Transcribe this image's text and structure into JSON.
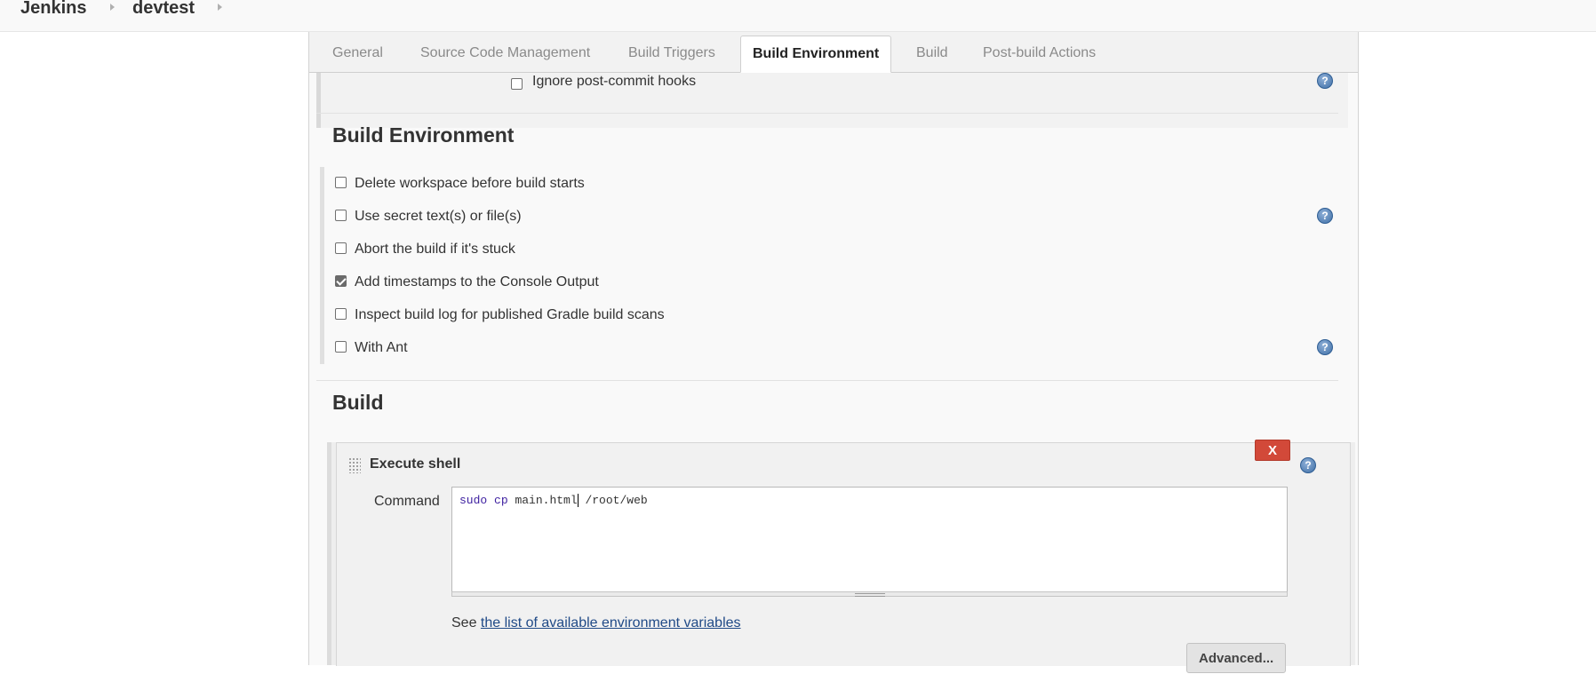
{
  "breadcrumb": {
    "root": "Jenkins",
    "job": "devtest"
  },
  "tabs": [
    {
      "label": "General",
      "active": false
    },
    {
      "label": "Source Code Management",
      "active": false
    },
    {
      "label": "Build Triggers",
      "active": false
    },
    {
      "label": "Build Environment",
      "active": true
    },
    {
      "label": "Build",
      "active": false
    },
    {
      "label": "Post-build Actions",
      "active": false
    }
  ],
  "scm": {
    "ignore_hooks_label": "Ignore post-commit hooks",
    "ignore_hooks_checked": false
  },
  "build_environment": {
    "title": "Build Environment",
    "options": [
      {
        "label": "Delete workspace before build starts",
        "checked": false,
        "help": false
      },
      {
        "label": "Use secret text(s) or file(s)",
        "checked": false,
        "help": true
      },
      {
        "label": "Abort the build if it's stuck",
        "checked": false,
        "help": false
      },
      {
        "label": "Add timestamps to the Console Output",
        "checked": true,
        "help": false
      },
      {
        "label": "Inspect build log for published Gradle build scans",
        "checked": false,
        "help": false
      },
      {
        "label": "With Ant",
        "checked": false,
        "help": true
      }
    ]
  },
  "build": {
    "title": "Build",
    "step": {
      "title": "Execute shell",
      "delete_label": "X",
      "command_label": "Command",
      "command_keyword1": "sudo",
      "command_keyword2": "cp",
      "command_rest": " main.html",
      "command_tail": " /root/web",
      "see_prefix": "See",
      "env_link": "the list of available environment variables",
      "advanced_label": "Advanced..."
    }
  },
  "icons": {
    "help": "question-mark-help-icon",
    "grip": "drag-grip-icon",
    "breadcrumb_sep": "chevron-right-icon"
  },
  "colors": {
    "delete": "#d24939",
    "link": "#204a87",
    "help": "#3f6fa6"
  }
}
